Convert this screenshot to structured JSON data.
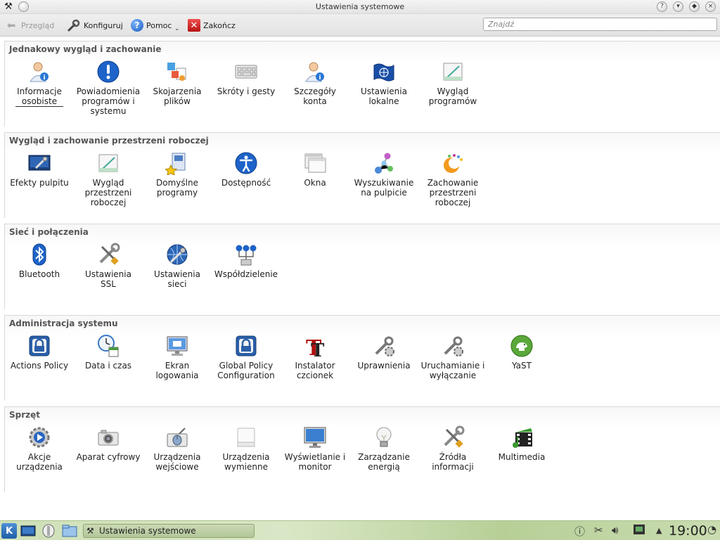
{
  "window": {
    "title": "Ustawienia systemowe",
    "left_icons": [
      "tools-icon",
      "circle-icon"
    ],
    "right_buttons": [
      {
        "name": "help-window-button",
        "glyph": "?"
      },
      {
        "name": "minimize-button",
        "glyph": "▾"
      },
      {
        "name": "maximize-button",
        "glyph": "◆"
      },
      {
        "name": "close-button",
        "glyph": "×"
      }
    ]
  },
  "toolbar": {
    "back_label": "Przegląd",
    "configure_label": "Konfiguruj",
    "help_label": "Pomoc",
    "quit_label": "Zakończ"
  },
  "search": {
    "placeholder": "Znajdź",
    "value": ""
  },
  "sections": [
    {
      "title": "Jednakowy wygląd i zachowanie",
      "items": [
        {
          "label": "Informacje\nosobiste",
          "icon": "user-info-icon"
        },
        {
          "label": "Powiadomienia\nprogramów i\nsystemu",
          "icon": "notification-icon"
        },
        {
          "label": "Skojarzenia\nplików",
          "icon": "file-association-icon"
        },
        {
          "label": "Skróty i gesty",
          "icon": "keyboard-shortcuts-icon"
        },
        {
          "label": "Szczegóły konta",
          "icon": "account-details-icon"
        },
        {
          "label": "Ustawienia\nlokalne",
          "icon": "locale-flag-icon"
        },
        {
          "label": "Wygląd\nprogramów",
          "icon": "app-appearance-icon"
        }
      ]
    },
    {
      "title": "Wygląd i zachowanie przestrzeni roboczej",
      "items": [
        {
          "label": "Efekty pulpitu",
          "icon": "desktop-effects-icon"
        },
        {
          "label": "Wygląd\nprzestrzeni\nroboczej",
          "icon": "workspace-appearance-icon"
        },
        {
          "label": "Domyślne\nprogramy",
          "icon": "default-apps-icon"
        },
        {
          "label": "Dostępność",
          "icon": "accessibility-icon"
        },
        {
          "label": "Okna",
          "icon": "windows-icon"
        },
        {
          "label": "Wyszukiwanie\nna pulpicie",
          "icon": "desktop-search-icon"
        },
        {
          "label": "Zachowanie\nprzestrzeni\nroboczej",
          "icon": "workspace-behavior-icon"
        }
      ]
    },
    {
      "title": "Sieć i połączenia",
      "items": [
        {
          "label": "Bluetooth",
          "icon": "bluetooth-icon"
        },
        {
          "label": "Ustawienia\nSSL",
          "icon": "ssl-tools-icon"
        },
        {
          "label": "Ustawienia\nsieci",
          "icon": "network-settings-icon"
        },
        {
          "label": "Współdzielenie",
          "icon": "sharing-icon"
        }
      ]
    },
    {
      "title": "Administracja systemu",
      "items": [
        {
          "label": "Actions Policy",
          "icon": "policy-lock-icon"
        },
        {
          "label": "Data i czas",
          "icon": "date-time-icon"
        },
        {
          "label": "Ekran\nlogowania",
          "icon": "login-screen-icon"
        },
        {
          "label": "Global Policy\nConfiguration",
          "icon": "global-policy-lock-icon"
        },
        {
          "label": "Instalator\nczcionek",
          "icon": "font-installer-icon"
        },
        {
          "label": "Uprawnienia",
          "icon": "permissions-icon"
        },
        {
          "label": "Uruchamianie i\nwyłączanie",
          "icon": "startup-shutdown-icon"
        },
        {
          "label": "YaST",
          "icon": "yast-icon"
        }
      ]
    },
    {
      "title": "Sprzęt",
      "items": [
        {
          "label": "Akcje\nurządzenia",
          "icon": "device-actions-icon"
        },
        {
          "label": "Aparat cyfrowy",
          "icon": "camera-icon"
        },
        {
          "label": "Urządzenia\nwejściowe",
          "icon": "input-devices-icon"
        },
        {
          "label": "Urządzenia\nwymienne",
          "icon": "removable-devices-icon"
        },
        {
          "label": "Wyświetlanie i\nmonitor",
          "icon": "monitor-icon"
        },
        {
          "label": "Zarządzanie\nenergią",
          "icon": "power-bulb-icon"
        },
        {
          "label": "Źródła\ninformacji",
          "icon": "info-sources-icon"
        },
        {
          "label": "Multimedia",
          "icon": "multimedia-icon"
        }
      ]
    }
  ],
  "taskbar": {
    "task_label": "Ustawienia systemowe",
    "clock": "19:00"
  }
}
